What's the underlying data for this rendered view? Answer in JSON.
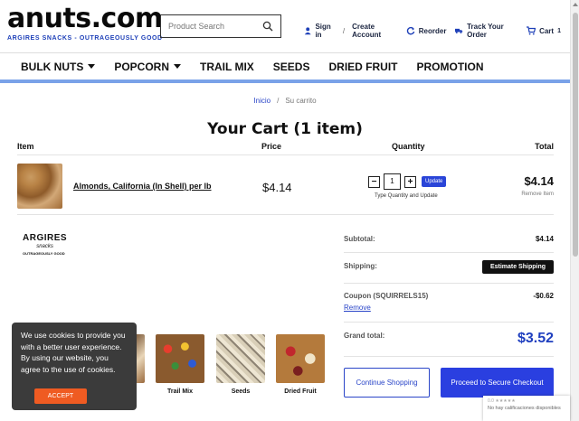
{
  "header": {
    "logo": "anuts.com",
    "tagline": "ARGIRES SNACKS - OUTRAGEOUSLY GOOD",
    "search_placeholder": "Product Search",
    "sign_in": "Sign in",
    "sep": "/",
    "create_account": "Create Account",
    "reorder": "Reorder",
    "track_order": "Track Your Order",
    "cart": "Cart",
    "cart_count": "1"
  },
  "nav": [
    "BULK NUTS",
    "POPCORN",
    "TRAIL MIX",
    "SEEDS",
    "DRIED FRUIT",
    "PROMOTION"
  ],
  "breadcrumb": {
    "home": "Inicio",
    "current": "Su carrito"
  },
  "title": "Your Cart (1 item)",
  "table": {
    "headers": {
      "item": "Item",
      "price": "Price",
      "quantity": "Quantity",
      "total": "Total"
    },
    "row": {
      "name": "Almonds, California (In Shell) per lb",
      "price": "$4.14",
      "qty": "1",
      "update": "Update",
      "qty_hint": "Type Quantity and Update",
      "total": "$4.14",
      "remove": "Remove Item"
    }
  },
  "brand": {
    "name": "ARGIRES",
    "script": "snacks",
    "tagline": "OUTRAGEOUSLY GOOD"
  },
  "categories": [
    {
      "label": "Trail Mix"
    },
    {
      "label": "Seeds"
    },
    {
      "label": "Dried Fruit"
    }
  ],
  "summary": {
    "subtotal_label": "Subtotal:",
    "subtotal_value": "$4.14",
    "shipping_label": "Shipping:",
    "shipping_button": "Estimate Shipping",
    "coupon_label": "Coupon (SQUIRRELS15)",
    "coupon_value": "-$0.62",
    "coupon_remove": "Remove",
    "grand_label": "Grand total:",
    "grand_value": "$3.52",
    "continue": "Continue Shopping",
    "checkout": "Proceed to Secure Checkout"
  },
  "cookie": {
    "text": "We use cookies to provide you with a better user experience. By using our website, you agree to the use of cookies.",
    "accept": "ACCEPT"
  },
  "rating": {
    "stars": "0.0 ★★★★★",
    "text": "No hay calificaciones disponibles"
  }
}
